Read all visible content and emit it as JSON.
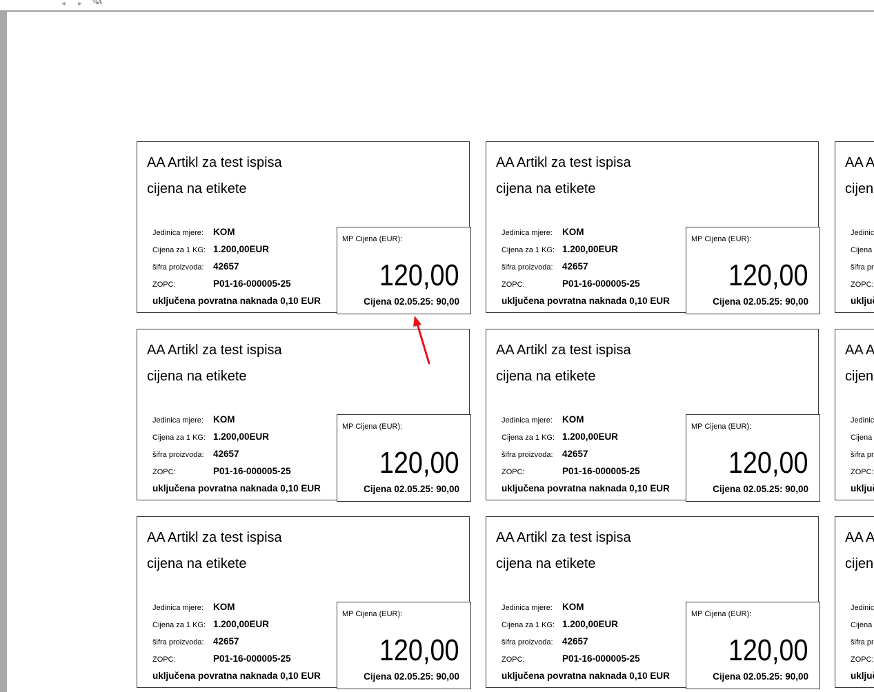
{
  "toolbar": {
    "prev_label": "◄",
    "next_label": "►",
    "zoom_label": "%A"
  },
  "label": {
    "name_line1": "AA Artikl za test ispisa",
    "name_line2": "cijena na etikete",
    "info": [
      {
        "key": "Jedinica mjere:",
        "value": "KOM"
      },
      {
        "key": "Cijena za 1 KG:",
        "value": "1.200,00EUR"
      },
      {
        "key": "šifra proizvoda:",
        "value": "42657"
      },
      {
        "key": "ZOPC:",
        "value": "P01-16-000005-25"
      }
    ],
    "deposit": "uključena povratna naknada 0,10 EUR",
    "price_title": "MP Cijena (EUR):",
    "price": "120,00",
    "previous_price": "Cijena 02.05.25: 90,00"
  },
  "layout": {
    "rows": 3,
    "columns_visible": 3
  },
  "annotation": {
    "arrow_color": "#e8141c"
  }
}
